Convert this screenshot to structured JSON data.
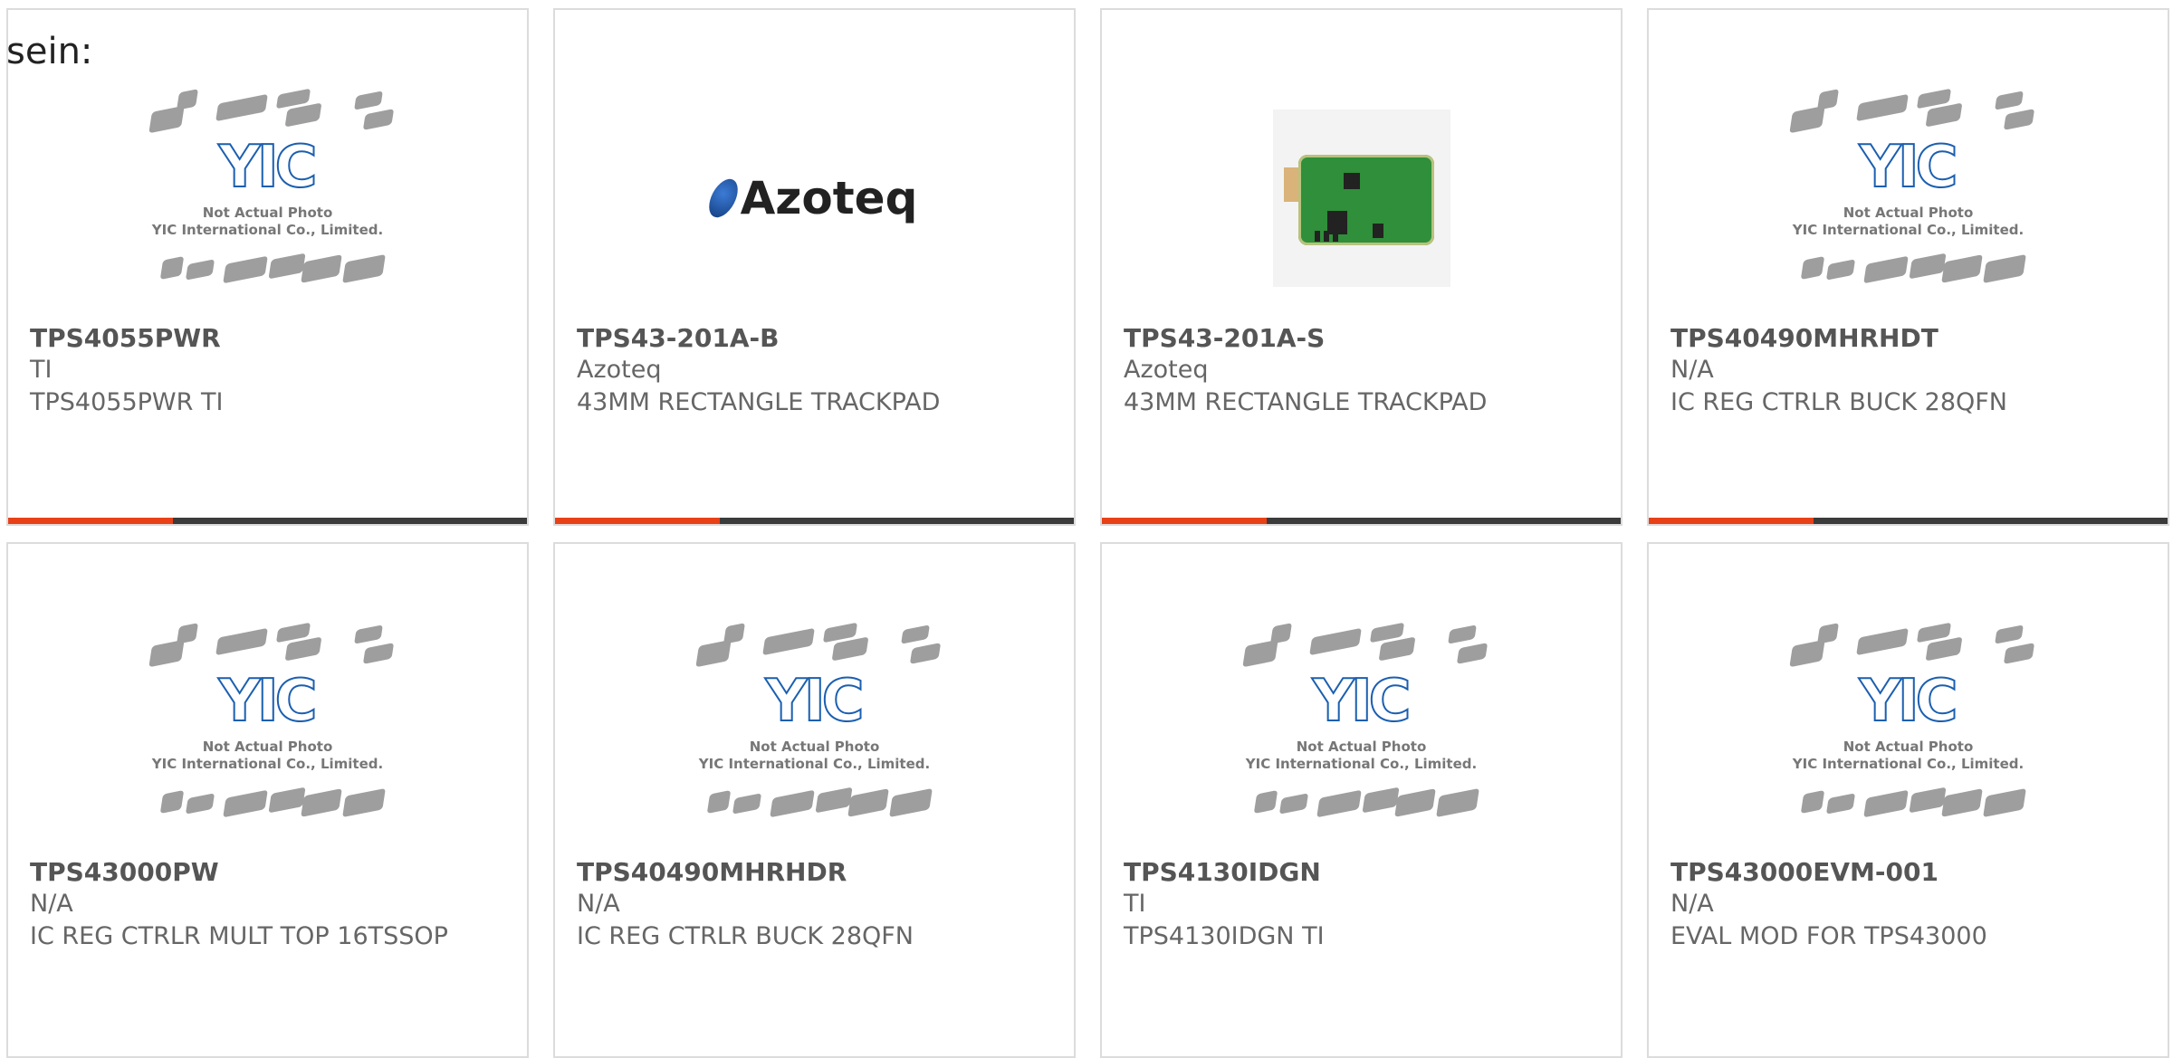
{
  "lead_text": "sein:",
  "products": [
    {
      "part_number": "TPS4055PWR",
      "manufacturer": "TI",
      "description": "TPS4055PWR TI",
      "image": "yic-placeholder",
      "image_text": [
        "Not Actual Photo",
        "YIC International Co., Limited."
      ]
    },
    {
      "part_number": "TPS43-201A-B",
      "manufacturer": "Azoteq",
      "description": "43MM RECTANGLE TRACKPAD",
      "image": "azoteq-logo",
      "image_text": [
        "Azoteq"
      ]
    },
    {
      "part_number": "TPS43-201A-S",
      "manufacturer": "Azoteq",
      "description": "43MM RECTANGLE TRACKPAD",
      "image": "trackpad-photo",
      "image_text": []
    },
    {
      "part_number": "TPS40490MHRHDT",
      "manufacturer": "N/A",
      "description": "IC REG CTRLR BUCK 28QFN",
      "image": "yic-placeholder",
      "image_text": [
        "Not Actual Photo",
        "YIC International Co., Limited."
      ]
    },
    {
      "part_number": "TPS43000PW",
      "manufacturer": "N/A",
      "description": "IC REG CTRLR MULT TOP 16TSSOP",
      "image": "yic-placeholder",
      "image_text": [
        "Not Actual Photo",
        "YIC International Co., Limited."
      ]
    },
    {
      "part_number": "TPS40490MHRHDR",
      "manufacturer": "N/A",
      "description": "IC REG CTRLR BUCK 28QFN",
      "image": "yic-placeholder",
      "image_text": [
        "Not Actual Photo",
        "YIC International Co., Limited."
      ]
    },
    {
      "part_number": "TPS4130IDGN",
      "manufacturer": "TI",
      "description": "TPS4130IDGN TI",
      "image": "yic-placeholder",
      "image_text": [
        "Not Actual Photo",
        "YIC International Co., Limited."
      ]
    },
    {
      "part_number": "TPS43000EVM-001",
      "manufacturer": "N/A",
      "description": "EVAL MOD FOR TPS43000",
      "image": "yic-placeholder",
      "image_text": [
        "Not Actual Photo",
        "YIC International Co., Limited."
      ]
    }
  ],
  "colors": {
    "accent_bar": "#e84118",
    "bar_dark": "#3b3b3b",
    "card_border": "#dcdcdc"
  }
}
